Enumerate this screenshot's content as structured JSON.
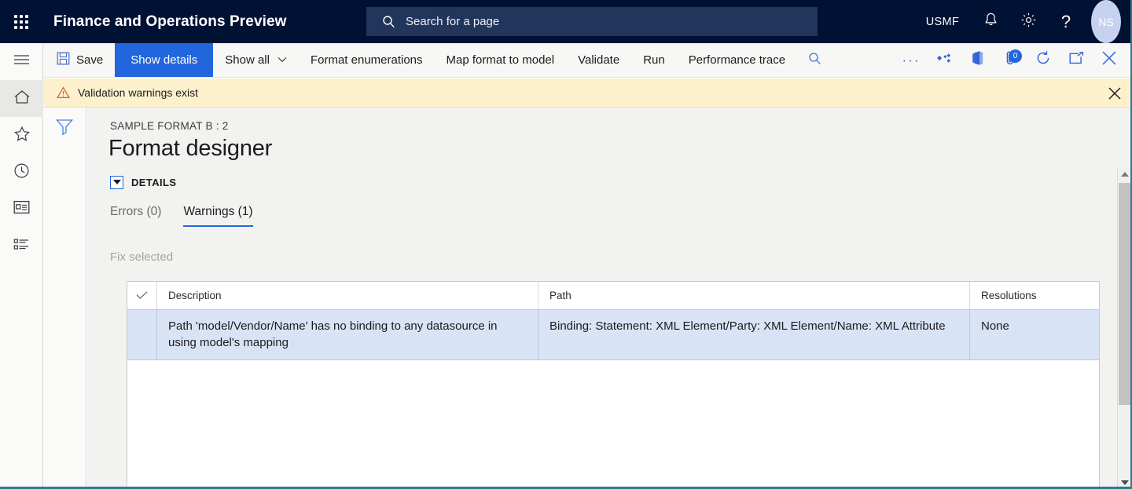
{
  "topbar": {
    "waffle_label": "App launcher",
    "app_title": "Finance and Operations Preview",
    "search_placeholder": "Search for a page",
    "company": "USMF",
    "notifications_icon": "bell-icon",
    "settings_icon": "gear-icon",
    "help_label": "?",
    "avatar_initials": "NS"
  },
  "rail": {
    "items": [
      {
        "name": "hamburger-menu",
        "label": "Expand the navigation pane"
      },
      {
        "name": "home",
        "label": "Home"
      },
      {
        "name": "favorites",
        "label": "Favorites"
      },
      {
        "name": "recent",
        "label": "Recent"
      },
      {
        "name": "workspaces",
        "label": "Workspaces"
      },
      {
        "name": "modules",
        "label": "Modules"
      }
    ]
  },
  "filter_pane": {
    "filter_icon": "filter-funnel-icon"
  },
  "commandbar": {
    "save": "Save",
    "show_details": "Show details",
    "show_all": "Show all",
    "format_enumerations": "Format enumerations",
    "map_format_to_model": "Map format to model",
    "validate": "Validate",
    "run": "Run",
    "performance_trace": "Performance trace",
    "search_icon": "search-icon",
    "overflow": "···",
    "share_icon": "share-icon",
    "office_icon": "open-in-office-icon",
    "attachments_icon": "attachments-icon",
    "attachments_count": "0",
    "refresh_icon": "refresh-icon",
    "popout_icon": "open-in-new-window-icon",
    "close_icon": "close-icon"
  },
  "warning_bar": {
    "icon": "warning-triangle-icon",
    "message": "Validation warnings exist",
    "close_icon": "close-icon"
  },
  "page": {
    "breadcrumb": "SAMPLE FORMAT B : 2",
    "title": "Format designer",
    "details_section_label": "DETAILS"
  },
  "tabs": [
    {
      "label": "Errors (0)",
      "active": false
    },
    {
      "label": "Warnings (1)",
      "active": true
    }
  ],
  "actions": {
    "fix_selected": "Fix selected"
  },
  "grid": {
    "columns": [
      {
        "key": "check",
        "label": "✓"
      },
      {
        "key": "description",
        "label": "Description"
      },
      {
        "key": "path",
        "label": "Path"
      },
      {
        "key": "resolutions",
        "label": "Resolutions"
      }
    ],
    "rows": [
      {
        "check": "",
        "description": "Path 'model/Vendor/Name' has no binding to any datasource in using model's mapping",
        "path": "Binding: Statement: XML Element/Party: XML Element/Name: XML Attribute",
        "resolutions": "None",
        "selected": true
      }
    ]
  },
  "scrollbar": {
    "up_label": "Scroll up",
    "down_label": "Scroll down"
  },
  "colors": {
    "topbar_bg": "#001234",
    "search_bg": "#22355b",
    "accent_blue": "#2266dd",
    "warning_bg": "#fdf1cd",
    "warning_icon": "#d8622a",
    "row_selected_bg": "#d8e3f6",
    "frame_teal": "#2d7b8a"
  }
}
